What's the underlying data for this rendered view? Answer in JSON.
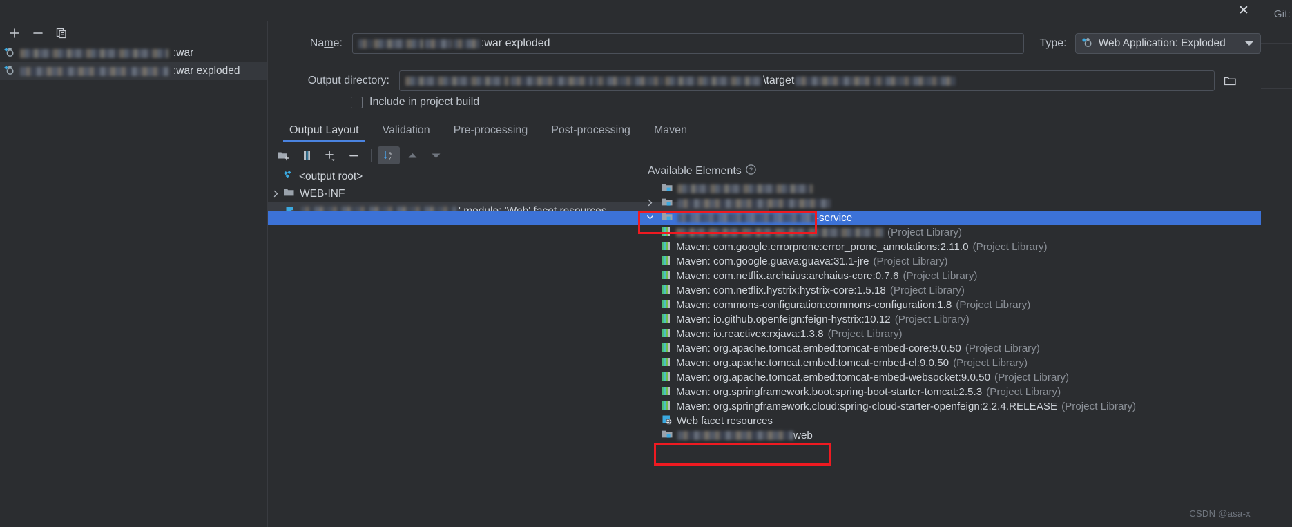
{
  "ide": {
    "right_strip_label": "Git:"
  },
  "titlebar": {
    "close_icon": "close-icon",
    "close_glyph": "✕"
  },
  "left_panel": {
    "toolbar": [
      {
        "name": "add-artifact-button",
        "glyph": "plus-icon"
      },
      {
        "name": "remove-artifact-button",
        "glyph": "minus-icon"
      },
      {
        "name": "copy-artifact-button",
        "glyph": "copy-icon"
      }
    ],
    "artifacts": [
      {
        "name_suffix": ":war",
        "selected": false,
        "icon": "artifact-icon"
      },
      {
        "name_suffix": ":war exploded",
        "selected": true,
        "icon": "artifact-icon"
      }
    ]
  },
  "form": {
    "name_label": "Name:",
    "name_value_suffix": ":war exploded",
    "type_label": "Type:",
    "type_value": "Web Application: Exploded",
    "output_dir_label": "Output directory:",
    "output_dir_suffix": "\\target",
    "include_in_project_build_label": "Include in project build",
    "include_in_project_build_checked": false
  },
  "tabs": [
    {
      "label": "Output Layout",
      "active": true
    },
    {
      "label": "Validation",
      "active": false
    },
    {
      "label": "Pre-processing",
      "active": false
    },
    {
      "label": "Post-processing",
      "active": false
    },
    {
      "label": "Maven",
      "active": false
    }
  ],
  "layout_toolbar": [
    {
      "name": "add-directory-button",
      "icon": "folder-add-icon",
      "toggled": false
    },
    {
      "name": "add-archive-button",
      "icon": "archive-icon",
      "toggled": false
    },
    {
      "name": "add-element-button",
      "icon": "plus-dropdown-icon",
      "toggled": false
    },
    {
      "name": "remove-element-button",
      "icon": "minus-icon",
      "toggled": false
    },
    {
      "name": "sort-alphabetically-button",
      "icon": "sort-az-icon",
      "toggled": true
    },
    {
      "name": "move-up-button",
      "icon": "arrow-up-icon",
      "toggled": false
    },
    {
      "name": "move-down-button",
      "icon": "arrow-down-icon",
      "toggled": false
    }
  ],
  "output_tree": [
    {
      "label": "<output root>",
      "icon": "artifact-icon",
      "indent": 0,
      "twisty": "none",
      "selected": false
    },
    {
      "label": "WEB-INF",
      "icon": "folder-icon",
      "indent": 0,
      "twisty": "collapsed",
      "selected": false
    },
    {
      "label": "' module: 'Web' facet resources",
      "icon": "web-facet-icon",
      "indent": 1,
      "twisty": "none",
      "selected": true,
      "blurred_prefix": true
    }
  ],
  "available_elements": {
    "header": "Available Elements",
    "help_icon": "help-icon",
    "items": [
      {
        "label": "",
        "icon": "module-icon",
        "twisty": "none",
        "indent": 1,
        "blurred": true,
        "selected": false
      },
      {
        "label": "",
        "icon": "module-icon",
        "twisty": "collapsed",
        "indent": 1,
        "blurred": true,
        "selected": false
      },
      {
        "label": "-service",
        "icon": "module-icon",
        "twisty": "expanded",
        "indent": 1,
        "blurred": true,
        "selected": true
      },
      {
        "label": "",
        "note": "(Project Library)",
        "icon": "library-icon",
        "twisty": "none",
        "indent": 2,
        "blurred": true,
        "selected": false
      },
      {
        "label": "Maven: com.google.errorprone:error_prone_annotations:2.11.0",
        "note": "(Project Library)",
        "icon": "library-icon",
        "twisty": "none",
        "indent": 2,
        "blurred": false,
        "selected": false
      },
      {
        "label": "Maven: com.google.guava:guava:31.1-jre",
        "note": "(Project Library)",
        "icon": "library-icon",
        "twisty": "none",
        "indent": 2,
        "blurred": false,
        "selected": false
      },
      {
        "label": "Maven: com.netflix.archaius:archaius-core:0.7.6",
        "note": "(Project Library)",
        "icon": "library-icon",
        "twisty": "none",
        "indent": 2,
        "blurred": false,
        "selected": false
      },
      {
        "label": "Maven: com.netflix.hystrix:hystrix-core:1.5.18",
        "note": "(Project Library)",
        "icon": "library-icon",
        "twisty": "none",
        "indent": 2,
        "blurred": false,
        "selected": false
      },
      {
        "label": "Maven: commons-configuration:commons-configuration:1.8",
        "note": "(Project Library)",
        "icon": "library-icon",
        "twisty": "none",
        "indent": 2,
        "blurred": false,
        "selected": false
      },
      {
        "label": "Maven: io.github.openfeign:feign-hystrix:10.12",
        "note": "(Project Library)",
        "icon": "library-icon",
        "twisty": "none",
        "indent": 2,
        "blurred": false,
        "selected": false
      },
      {
        "label": "Maven: io.reactivex:rxjava:1.3.8",
        "note": "(Project Library)",
        "icon": "library-icon",
        "twisty": "none",
        "indent": 2,
        "blurred": false,
        "selected": false
      },
      {
        "label": "Maven: org.apache.tomcat.embed:tomcat-embed-core:9.0.50",
        "note": "(Project Library)",
        "icon": "library-icon",
        "twisty": "none",
        "indent": 2,
        "blurred": false,
        "selected": false
      },
      {
        "label": "Maven: org.apache.tomcat.embed:tomcat-embed-el:9.0.50",
        "note": "(Project Library)",
        "icon": "library-icon",
        "twisty": "none",
        "indent": 2,
        "blurred": false,
        "selected": false
      },
      {
        "label": "Maven: org.apache.tomcat.embed:tomcat-embed-websocket:9.0.50",
        "note": "(Project Library)",
        "icon": "library-icon",
        "twisty": "none",
        "indent": 2,
        "blurred": false,
        "selected": false
      },
      {
        "label": "Maven: org.springframework.boot:spring-boot-starter-tomcat:2.5.3",
        "note": "(Project Library)",
        "icon": "library-icon",
        "twisty": "none",
        "indent": 2,
        "blurred": false,
        "selected": false
      },
      {
        "label": "Maven: org.springframework.cloud:spring-cloud-starter-openfeign:2.2.4.RELEASE",
        "note": "(Project Library)",
        "icon": "library-icon",
        "twisty": "none",
        "indent": 2,
        "blurred": false,
        "selected": false
      },
      {
        "label": "Web facet resources",
        "icon": "web-facet-icon",
        "twisty": "none",
        "indent": 2,
        "blurred": false,
        "selected": false
      },
      {
        "label": "web",
        "icon": "module-icon",
        "twisty": "none",
        "indent": 2,
        "blurred": true,
        "selected": false
      }
    ]
  },
  "annotations": {
    "highlight_color": "#ef1a21",
    "boxes": [
      {
        "name": "highlight-service-module"
      },
      {
        "name": "highlight-web-module"
      }
    ]
  },
  "watermark": {
    "text": "CSDN @asa-x"
  },
  "colors": {
    "background": "#2b2d30",
    "selection_blue": "#3c72d7",
    "accent": "#4a83e0",
    "text": "#ced3d9",
    "muted_text": "#8b9097"
  }
}
